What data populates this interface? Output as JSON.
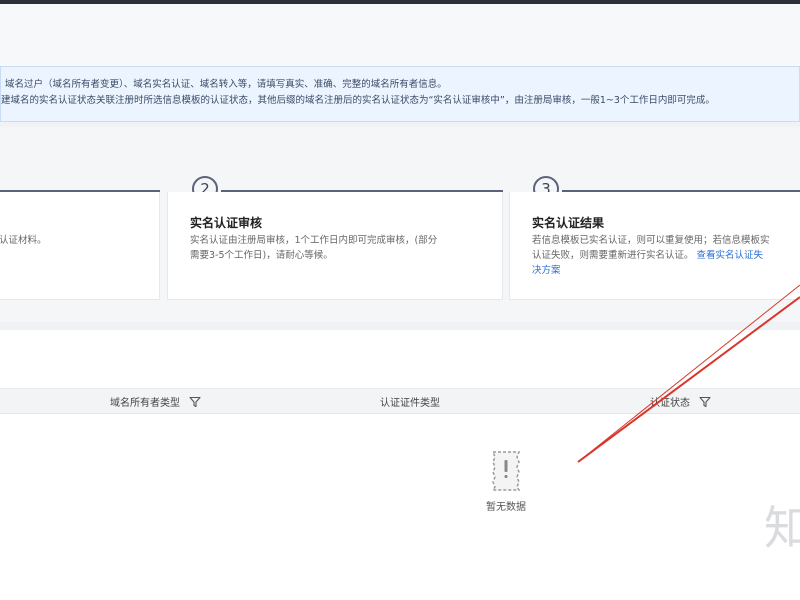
{
  "notice": {
    "line1": "域名过户（域名所有者变更）、域名实名认证、域名转入等，请填写真实、准确、完整的域名所有者信息。",
    "line2": "建域名的实名认证状态关联注册时所选信息模板的认证状态，其他后缀的域名注册后的实名认证状态为“实名认证审核中”，由注册局审核，一般1~3个工作日内即可完成。"
  },
  "steps": [
    {
      "number": "",
      "title": "",
      "desc_lines": [
        "认证材料。"
      ]
    },
    {
      "number": "2",
      "title": "实名认证审核",
      "desc_lines": [
        "实名认证由注册局审核，1个工作日内即可完成审核，(部分",
        "需要3-5个工作日)，请耐心等候。"
      ]
    },
    {
      "number": "3",
      "title": "实名认证结果",
      "desc_lines": [
        "若信息模板已实名认证，则可以重复使用；若信息模板实",
        "认证失败，则需要重新进行实名认证。"
      ],
      "link_text": "查看实名认证失",
      "desc_line3": "决方案"
    }
  ],
  "table": {
    "columns": [
      {
        "label": "域名所有者类型",
        "filter": true
      },
      {
        "label": "认证证件类型",
        "filter": false
      },
      {
        "label": "认证状态",
        "filter": true
      }
    ],
    "empty_text": "暂无数据"
  },
  "watermark": "知",
  "colors": {
    "accent": "#2b6fd6",
    "arrow": "#d9362b",
    "notice_bg": "#ecf4ff"
  }
}
